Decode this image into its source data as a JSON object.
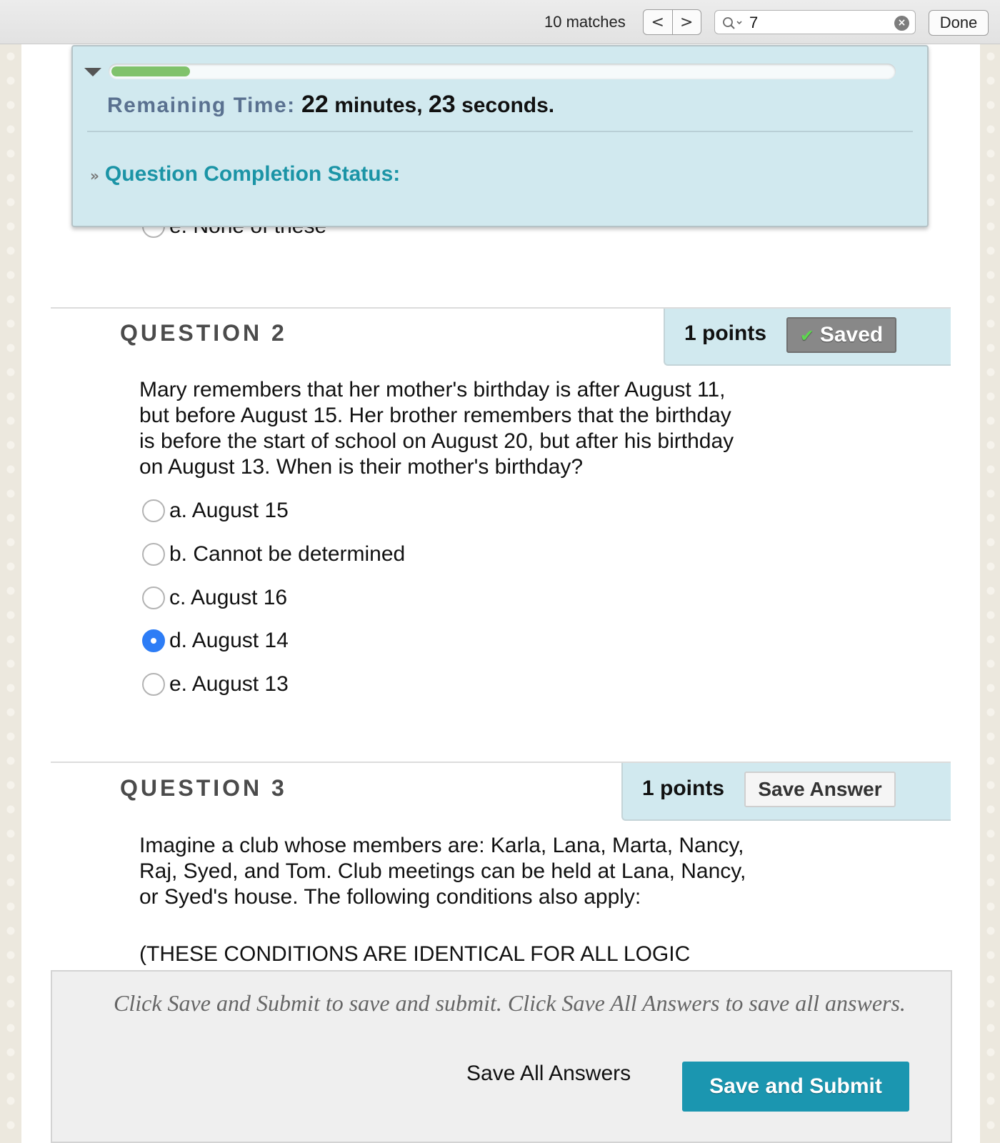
{
  "findbar": {
    "matches": "10 matches",
    "prev_label": "<",
    "next_label": ">",
    "query": "7",
    "done_label": "Done"
  },
  "timer": {
    "progress_fraction": 0.1,
    "label": "Remaining Time:",
    "minutes": "22",
    "minutes_unit": "minutes,",
    "seconds": "23",
    "seconds_unit": "seconds.",
    "status_label": "Question Completion Status:"
  },
  "previous_question": {
    "visible_option": "e. None of these"
  },
  "questions": [
    {
      "title": "QUESTION 2",
      "points": "1 points",
      "button_label": "Saved",
      "text": "Mary remembers that her mother's birthday is after August 11, but before August 15. Her brother remembers that the birthday is before the start of school on August 20, but after his birthday on August 13. When is their mother's birthday?",
      "options": [
        {
          "label": "a. August 15",
          "checked": false
        },
        {
          "label": "b. Cannot be determined",
          "checked": false
        },
        {
          "label": "c. August 16",
          "checked": false
        },
        {
          "label": "d. August 14",
          "checked": true
        },
        {
          "label": "e. August 13",
          "checked": false
        }
      ]
    },
    {
      "title": "QUESTION 3",
      "points": "1 points",
      "button_label": "Save Answer",
      "text": "Imagine a club whose members are: Karla, Lana, Marta, Nancy, Raj, Syed, and Tom. Club meetings can be held at Lana, Nancy, or Syed's house. The following conditions also apply:",
      "text2": "(THESE CONDITIONS ARE IDENTICAL FOR ALL LOGIC"
    }
  ],
  "submit": {
    "hint": "Click Save and Submit to save and submit. Click Save All Answers to save all answers.",
    "save_all_label": "Save All Answers",
    "submit_label": "Save and Submit"
  },
  "colors": {
    "panel": "#d1e9ef",
    "accent": "#1b96b0",
    "radio_checked": "#2d7df6",
    "progress": "#80c26b"
  }
}
